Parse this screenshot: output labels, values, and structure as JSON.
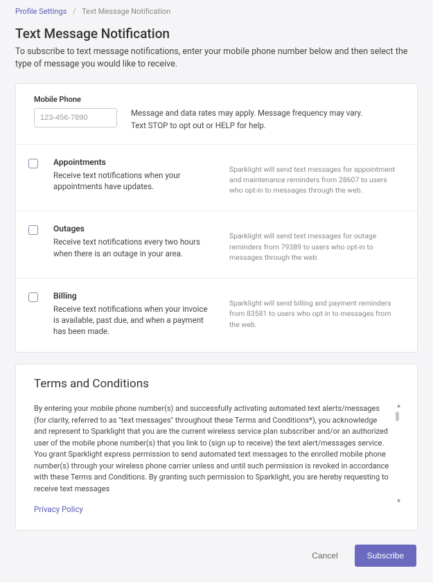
{
  "breadcrumb": {
    "parent": "Profile Settings",
    "current": "Text Message Notification"
  },
  "header": {
    "title": "Text Message Notification",
    "subtitle": "To subscribe to text message notifications, enter your mobile phone number below and then select the type of message you would like to receive."
  },
  "phone": {
    "label": "Mobile Phone",
    "placeholder": "123-456-7890",
    "help1": "Message and data rates may apply. Message frequency may vary.",
    "help2": "Text STOP to opt out or HELP for help."
  },
  "options": [
    {
      "title": "Appointments",
      "desc": "Receive text notifications when your appointments have updates.",
      "meta": "Sparklight will send text messages for appointment and maintenance reminders from 28607 to users who opt-in to messages through the web."
    },
    {
      "title": "Outages",
      "desc": "Receive text notifications every two hours when there is an outage in your area.",
      "meta": "Sparklight will send text messages for outage reminders from 79389 to users who opt-in to messages through the web."
    },
    {
      "title": "Billing",
      "desc": "Receive text notifications when your invoice is available, past due, and when a payment has been made.",
      "meta": "Sparklight will send billing and payment reminders from 83581 to users who opt in to messages from the web."
    }
  ],
  "terms": {
    "title": "Terms and Conditions",
    "body": "By entering your mobile phone number(s) and successfully activating automated text alerts/messages (for clarity, referred to as \"text messages\" throughout these Terms and Conditions*), you acknowledge and represent to Sparklight that you are the current wireless service plan subscriber and/or an authorized user of the mobile phone number(s) that you link to (sign up to receive) the text alert/messages service. You grant Sparklight express permission to send automated text messages to the enrolled mobile phone number(s) through your wireless phone carrier unless and until such permission is revoked in accordance with these Terms and Conditions. By granting such permission to Sparklight, you are hereby requesting to receive text messages",
    "privacy": "Privacy Policy"
  },
  "actions": {
    "cancel": "Cancel",
    "subscribe": "Subscribe"
  }
}
